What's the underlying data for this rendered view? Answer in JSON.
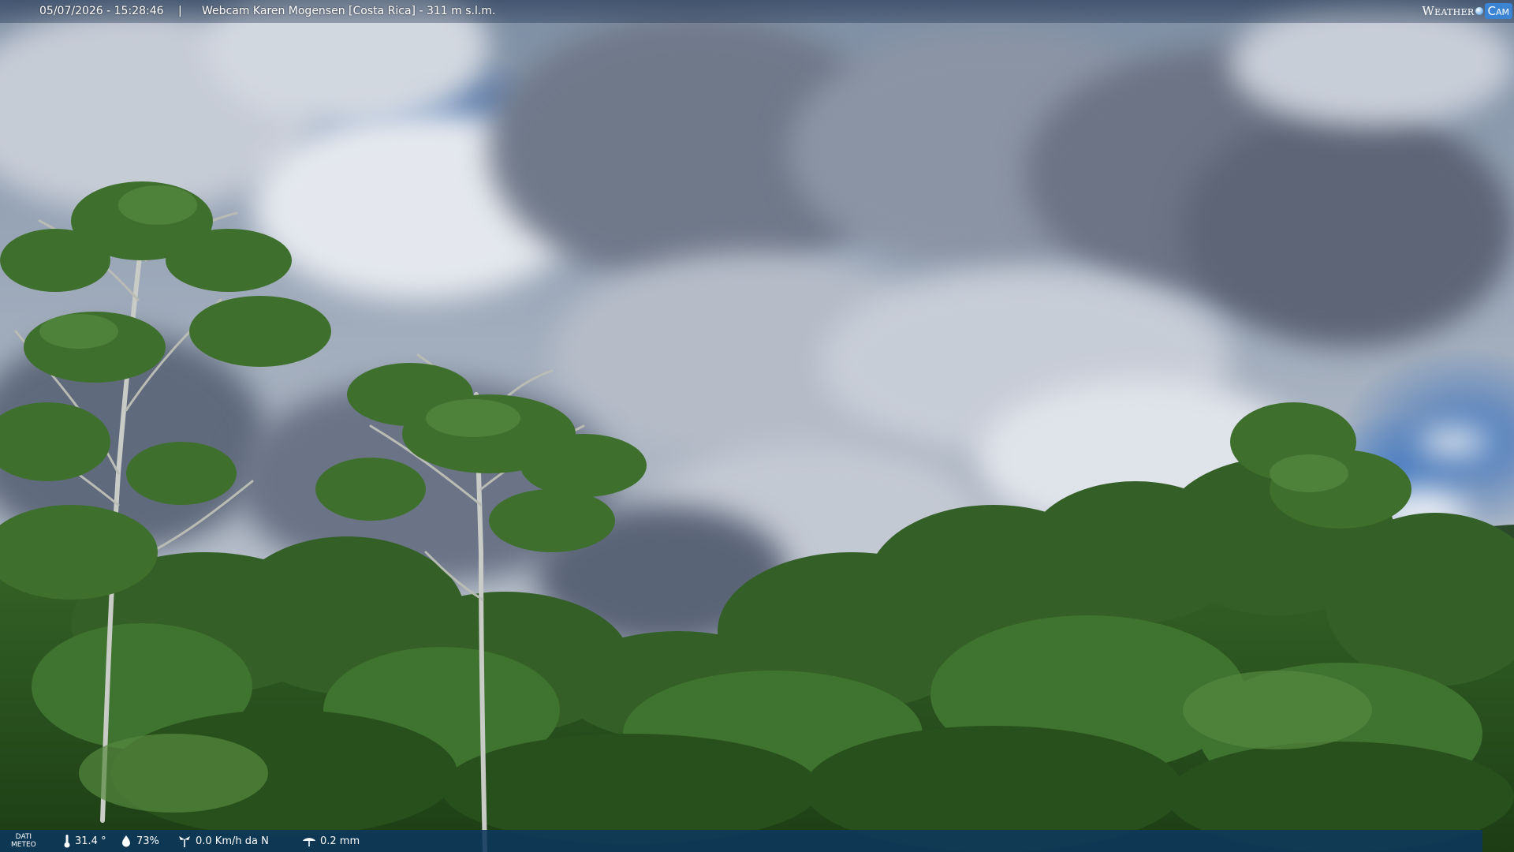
{
  "header": {
    "datetime": "05/07/2026 - 15:28:46",
    "separator": "|",
    "title": "Webcam Karen Mogensen [Costa Rica] - 311 m s.l.m."
  },
  "logo": {
    "text_weather": "Weather",
    "text_cam": "Cam"
  },
  "weather": {
    "label_line1": "DATI",
    "label_line2": "METEO",
    "temperature": "31.4 °",
    "humidity": "73%",
    "wind": "0.0 Km/h da N",
    "rain": "0.2 mm",
    "icons": [
      "thermometer-icon",
      "humidity-icon",
      "wind-icon",
      "rain-icon"
    ]
  },
  "colors": {
    "bar_background": "#0c375c",
    "sky_blue": "#3c72bb",
    "foliage": "#2e5a22"
  }
}
